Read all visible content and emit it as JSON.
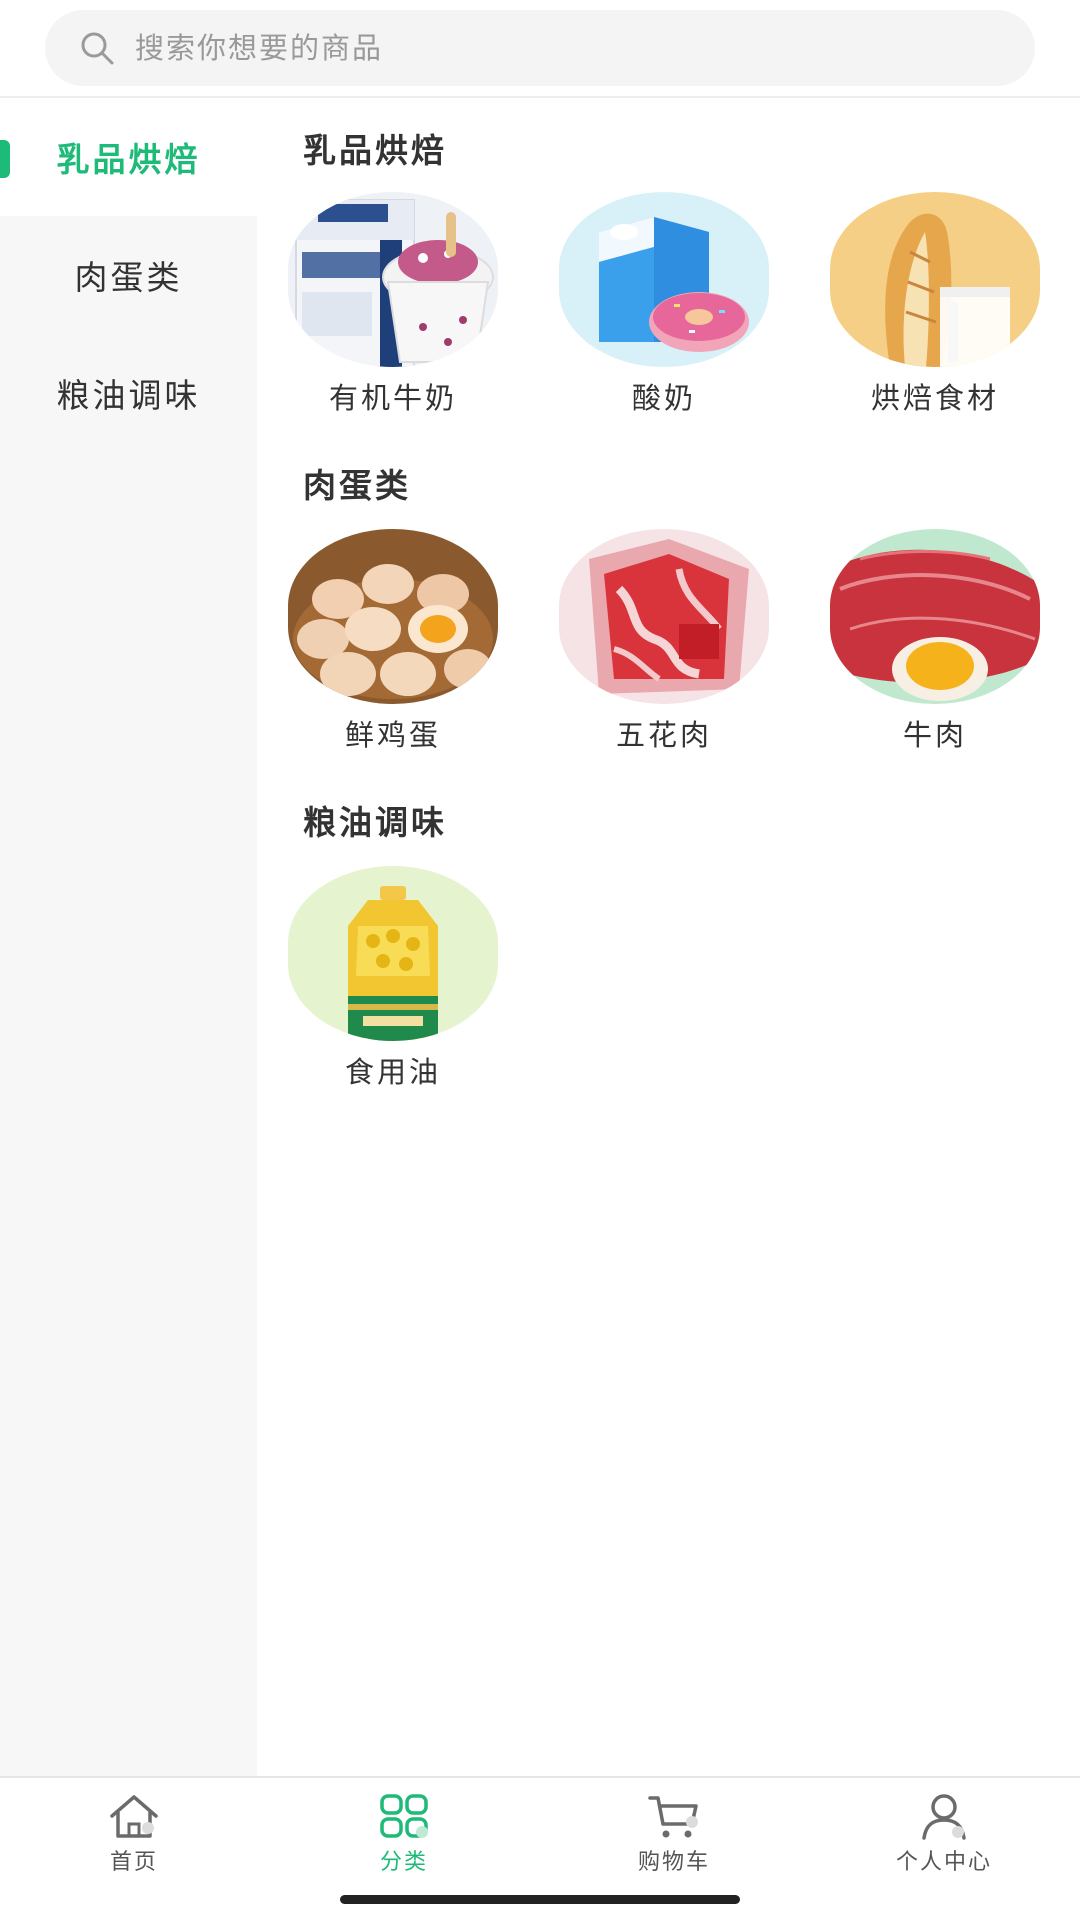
{
  "search": {
    "placeholder": "搜索你想要的商品",
    "icon": "search-icon"
  },
  "sidebar": {
    "active_index": 0,
    "items": [
      {
        "label": "乳品烘焙"
      },
      {
        "label": "肉蛋类"
      },
      {
        "label": "粮油调味"
      }
    ]
  },
  "sections": [
    {
      "title": "乳品烘焙",
      "products": [
        {
          "name": "有机牛奶",
          "image": "milk-carton-and-ice-cream"
        },
        {
          "name": "酸奶",
          "image": "blue-milk-carton-with-donut"
        },
        {
          "name": "烘焙食材",
          "image": "baguette-and-milk-glass"
        }
      ]
    },
    {
      "title": "肉蛋类",
      "products": [
        {
          "name": "鲜鸡蛋",
          "image": "eggs-in-basket"
        },
        {
          "name": "五花肉",
          "image": "pork-belly-slices"
        },
        {
          "name": "牛肉",
          "image": "beef-with-egg-yolk"
        }
      ]
    },
    {
      "title": "粮油调味",
      "products": [
        {
          "name": "食用油",
          "image": "cooking-oil-bottle"
        }
      ]
    }
  ],
  "tabbar": {
    "active_index": 1,
    "items": [
      {
        "label": "首页",
        "icon": "home-icon"
      },
      {
        "label": "分类",
        "icon": "grid-icon"
      },
      {
        "label": "购物车",
        "icon": "cart-icon"
      },
      {
        "label": "个人中心",
        "icon": "user-icon"
      }
    ]
  },
  "colors": {
    "accent": "#1dba78",
    "sidebar_background": "#f7f7f7",
    "search_background": "#f4f4f4",
    "text": "#333333",
    "placeholder": "#999999"
  }
}
